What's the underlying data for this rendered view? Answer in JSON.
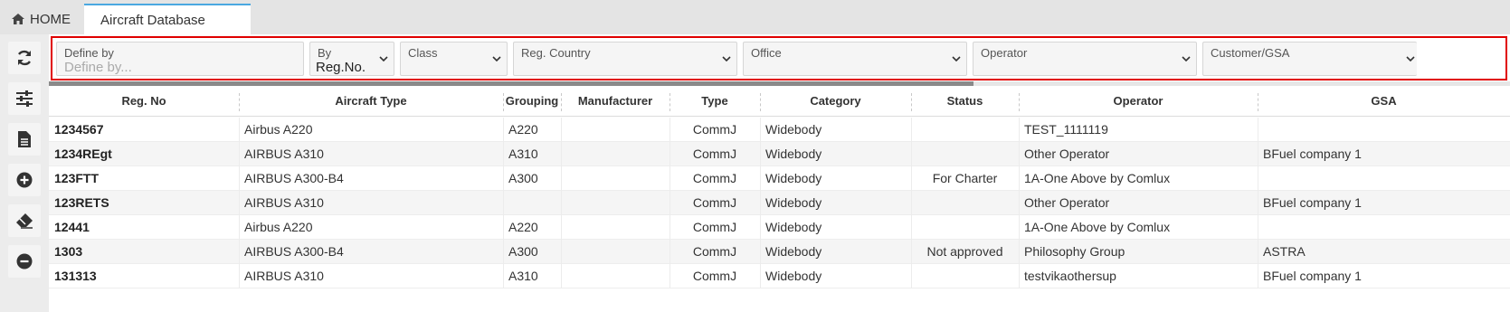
{
  "tabs": {
    "home_label": "HOME",
    "active_label": "Aircraft Database"
  },
  "sidebar": {
    "buttons": [
      {
        "icon": "refresh-icon"
      },
      {
        "icon": "sliders-icon"
      },
      {
        "icon": "document-icon"
      },
      {
        "icon": "add-circle-icon"
      },
      {
        "icon": "eraser-icon"
      },
      {
        "icon": "remove-circle-icon"
      }
    ]
  },
  "filters": {
    "define_by": {
      "label": "Define by",
      "placeholder": "Define by..."
    },
    "by": {
      "label": "By",
      "value": "Reg.No."
    },
    "class": {
      "label": "Class"
    },
    "reg_country": {
      "label": "Reg. Country"
    },
    "office": {
      "label": "Office"
    },
    "operator": {
      "label": "Operator"
    },
    "customer_gsa": {
      "label": "Customer/GSA"
    }
  },
  "table": {
    "columns": [
      "Reg. No",
      "Aircraft Type",
      "Grouping",
      "Manufacturer",
      "Type",
      "Category",
      "Status",
      "Operator",
      "GSA"
    ],
    "rows": [
      [
        "1234567",
        "Airbus A220",
        "A220",
        "",
        "CommJ",
        "Widebody",
        "",
        "TEST_1111119",
        ""
      ],
      [
        "1234REgt",
        "AIRBUS A310",
        "A310",
        "",
        "CommJ",
        "Widebody",
        "",
        "Other Operator",
        "BFuel company 1"
      ],
      [
        "123FTT",
        "AIRBUS A300-B4",
        "A300",
        "",
        "CommJ",
        "Widebody",
        "For Charter",
        "1A-One Above by Comlux",
        ""
      ],
      [
        "123RETS",
        "AIRBUS A310",
        "",
        "",
        "CommJ",
        "Widebody",
        "",
        "Other Operator",
        "BFuel company 1"
      ],
      [
        "12441",
        "Airbus A220",
        "A220",
        "",
        "CommJ",
        "Widebody",
        "",
        "1A-One Above by Comlux",
        ""
      ],
      [
        "1303",
        "AIRBUS A300-B4",
        "A300",
        "",
        "CommJ",
        "Widebody",
        "Not approved",
        "Philosophy Group",
        "ASTRA"
      ],
      [
        "131313",
        "AIRBUS A310",
        "A310",
        "",
        "CommJ",
        "Widebody",
        "",
        "testvikaothersup",
        "BFuel company 1"
      ]
    ]
  },
  "colors": {
    "highlight_border": "#e00000",
    "active_tab_accent": "#4aa8e0"
  }
}
